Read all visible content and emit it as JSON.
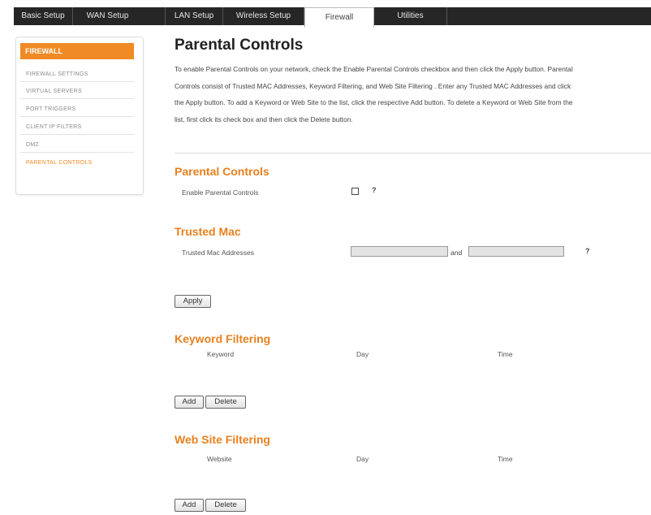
{
  "tabs": [
    {
      "label": "Basic Setup"
    },
    {
      "label": "WAN Setup"
    },
    {
      "label": "LAN Setup"
    },
    {
      "label": "Wireless Setup"
    },
    {
      "label": "Firewall"
    },
    {
      "label": "Utilities"
    }
  ],
  "sidebar": {
    "header": "FIREWALL",
    "items": [
      {
        "label": "FIREWALL SETTINGS"
      },
      {
        "label": "VIRTUAL SERVERS"
      },
      {
        "label": "PORT TRIGGERS"
      },
      {
        "label": "CLIENT IP FILTERS"
      },
      {
        "label": "DMZ"
      },
      {
        "label": "PARENTAL CONTROLS"
      }
    ]
  },
  "page": {
    "title": "Parental Controls",
    "intro_lines": [
      "To enable Parental Controls on your network, check the Enable Parental Controls checkbox and then click the Apply button. Parental",
      "Controls consist of Trusted MAC Addresses, Keyword Filtering, and Web Site Filtering . Enter any Trusted MAC Addresses and click",
      "the Apply button. To add a Keyword or Web Site to the list, click the respective Add button. To delete a Keyword or Web Site from the",
      "list, first click its check box and then click the Delete button."
    ]
  },
  "parental": {
    "title": "Parental Controls",
    "enable_label": "Enable Parental Controls",
    "enabled": false,
    "help": "?"
  },
  "trusted_mac": {
    "title": "Trusted Mac",
    "label": "Trusted Mac Addresses",
    "value1": "",
    "value2": "",
    "and_label": "and",
    "help": "?",
    "apply_label": "Apply"
  },
  "keyword_filtering": {
    "title": "Keyword Filtering",
    "columns": [
      "Keyword",
      "Day",
      "Time"
    ],
    "add_label": "Add",
    "delete_label": "Delete"
  },
  "website_filtering": {
    "title": "Web Site Filtering",
    "columns": [
      "Website",
      "Day",
      "Time"
    ],
    "add_label": "Add",
    "delete_label": "Delete"
  },
  "colors": {
    "accent": "#f08a24",
    "section_title": "#e8801e",
    "tab_bar": "#262626"
  }
}
